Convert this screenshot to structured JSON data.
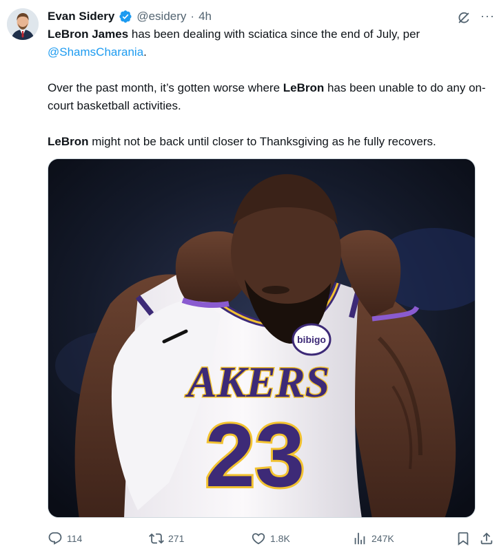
{
  "author": {
    "name": "Evan Sidery",
    "handle": "@esidery",
    "separator": "·",
    "time": "4h"
  },
  "tweet": {
    "p1_bold": "LeBron James",
    "p1_text": " has been dealing with sciatica since the end of July, per ",
    "p1_mention": "@ShamsCharania",
    "p1_end": ".",
    "p2_start": "Over the past month, it’s gotten worse where ",
    "p2_bold": "LeBron",
    "p2_end": " has been unable to do any on-court basketball activities.",
    "p3_bold": "LeBron",
    "p3_end": " might not be back until closer to Thanksgiving as he fully recovers."
  },
  "media": {
    "jersey_text": "AKERS",
    "jersey_number": "23",
    "patch_text": "bibigo"
  },
  "actions": {
    "replies": "114",
    "reposts": "271",
    "likes": "1.8K",
    "views": "247K"
  },
  "icons": {
    "verified": "verified-badge-icon",
    "grok": "grok-icon",
    "more": "more-icon",
    "reply": "reply-icon",
    "repost": "repost-icon",
    "like": "heart-icon",
    "views": "views-icon",
    "bookmark": "bookmark-icon",
    "share": "share-icon"
  },
  "colors": {
    "accent": "#1d9bf0",
    "text": "#0f1419",
    "secondary": "#536471",
    "lakers_purple": "#3d2a77",
    "lakers_gold": "#f2c230"
  }
}
